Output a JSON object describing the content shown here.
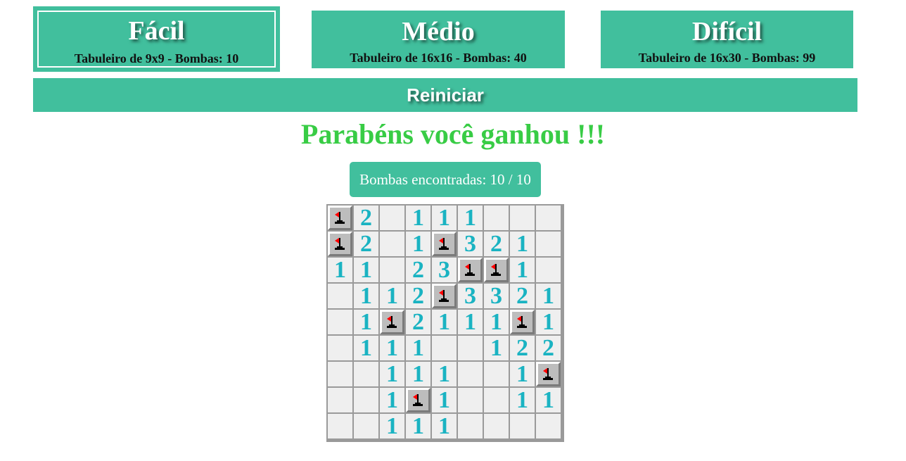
{
  "difficulties": [
    {
      "title": "Fácil",
      "subtitle": "Tabuleiro de 9x9 - Bombas: 10",
      "selected": true
    },
    {
      "title": "Médio",
      "subtitle": "Tabuleiro de 16x16 - Bombas: 40",
      "selected": false
    },
    {
      "title": "Difícil",
      "subtitle": "Tabuleiro de 16x30 - Bombas: 99",
      "selected": false
    }
  ],
  "restart_label": "Reiniciar",
  "status_message": "Parabéns você ganhou !!!",
  "bomb_counter": "Bombas encontradas: 10 / 10",
  "colors": {
    "accent": "#41bf9d",
    "win_text": "#38cc45",
    "number_text": "#1ab3c2"
  },
  "board": {
    "rows": [
      [
        "F",
        "2",
        "",
        "1",
        "1",
        "1",
        "",
        "",
        ""
      ],
      [
        "F",
        "2",
        "",
        "1",
        "F",
        "3",
        "2",
        "1",
        ""
      ],
      [
        "1",
        "1",
        "",
        "2",
        "3",
        "F",
        "F",
        "1",
        ""
      ],
      [
        "",
        "1",
        "1",
        "2",
        "F",
        "3",
        "3",
        "2",
        "1"
      ],
      [
        "",
        "1",
        "F",
        "2",
        "1",
        "1",
        "1",
        "F",
        "1"
      ],
      [
        "",
        "1",
        "1",
        "1",
        "",
        "",
        "1",
        "2",
        "2"
      ],
      [
        "",
        "",
        "1",
        "1",
        "1",
        "",
        "",
        "1",
        "F"
      ],
      [
        "",
        "",
        "1",
        "F",
        "1",
        "",
        "",
        "1",
        "1"
      ],
      [
        "",
        "",
        "1",
        "1",
        "1",
        "",
        "",
        "",
        ""
      ]
    ],
    "flag_icon": "flag-icon"
  }
}
